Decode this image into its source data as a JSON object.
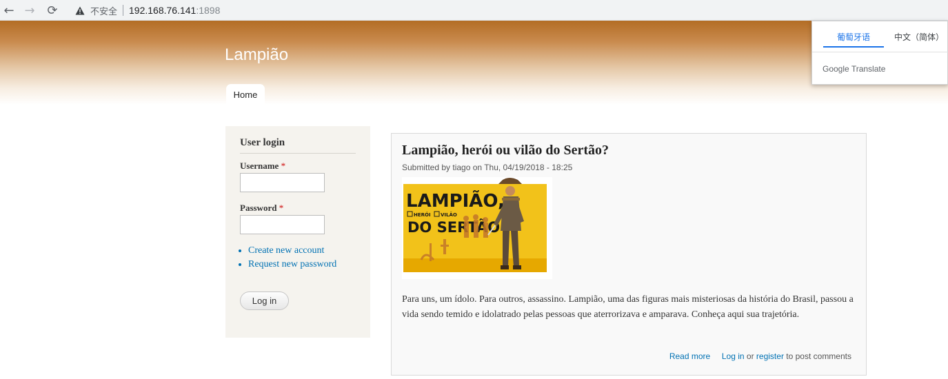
{
  "browser": {
    "back_icon": "←",
    "forward_icon": "→",
    "reload_icon": "⟳",
    "security_label": "不安全",
    "url_host": "192.168.76.141",
    "url_port": ":1898"
  },
  "site": {
    "name": "Lampião",
    "nav": {
      "home": "Home"
    }
  },
  "translate": {
    "tab_active": "葡萄牙语",
    "tab_other": "中文（简体）",
    "brand": "Google Translate",
    "accent": "#1a73e8"
  },
  "login": {
    "title": "User login",
    "username_label": "Username",
    "password_label": "Password",
    "required_mark": "*",
    "username_value": "",
    "password_value": "",
    "links": [
      "Create new account",
      "Request new password"
    ],
    "button": "Log in"
  },
  "article": {
    "title": "Lampião, herói ou vilão do Sertão?",
    "submitted": "Submitted by tiago on Thu, 04/19/2018 - 18:25",
    "image": {
      "line1": "LAMPIÃO,",
      "option1": "HERÓI",
      "option2": "VILÃO",
      "line2": "DO SERTÃO"
    },
    "body": "Para uns, um ídolo. Para outros, assassino. Lampião, uma das figuras mais misteriosas da história do Brasil, passou a vida sendo temido e idolatrado pelas pessoas que aterrorizava e amparava. Conheça aqui sua trajetória.",
    "read_more": "Read more",
    "login_link": "Log in",
    "or_text": "or",
    "register_link": "register",
    "to_post": "to post comments"
  },
  "colors": {
    "header_brown": "#b36d25",
    "link_blue": "#0071b3",
    "sidebar_bg": "#f5f3ee"
  }
}
